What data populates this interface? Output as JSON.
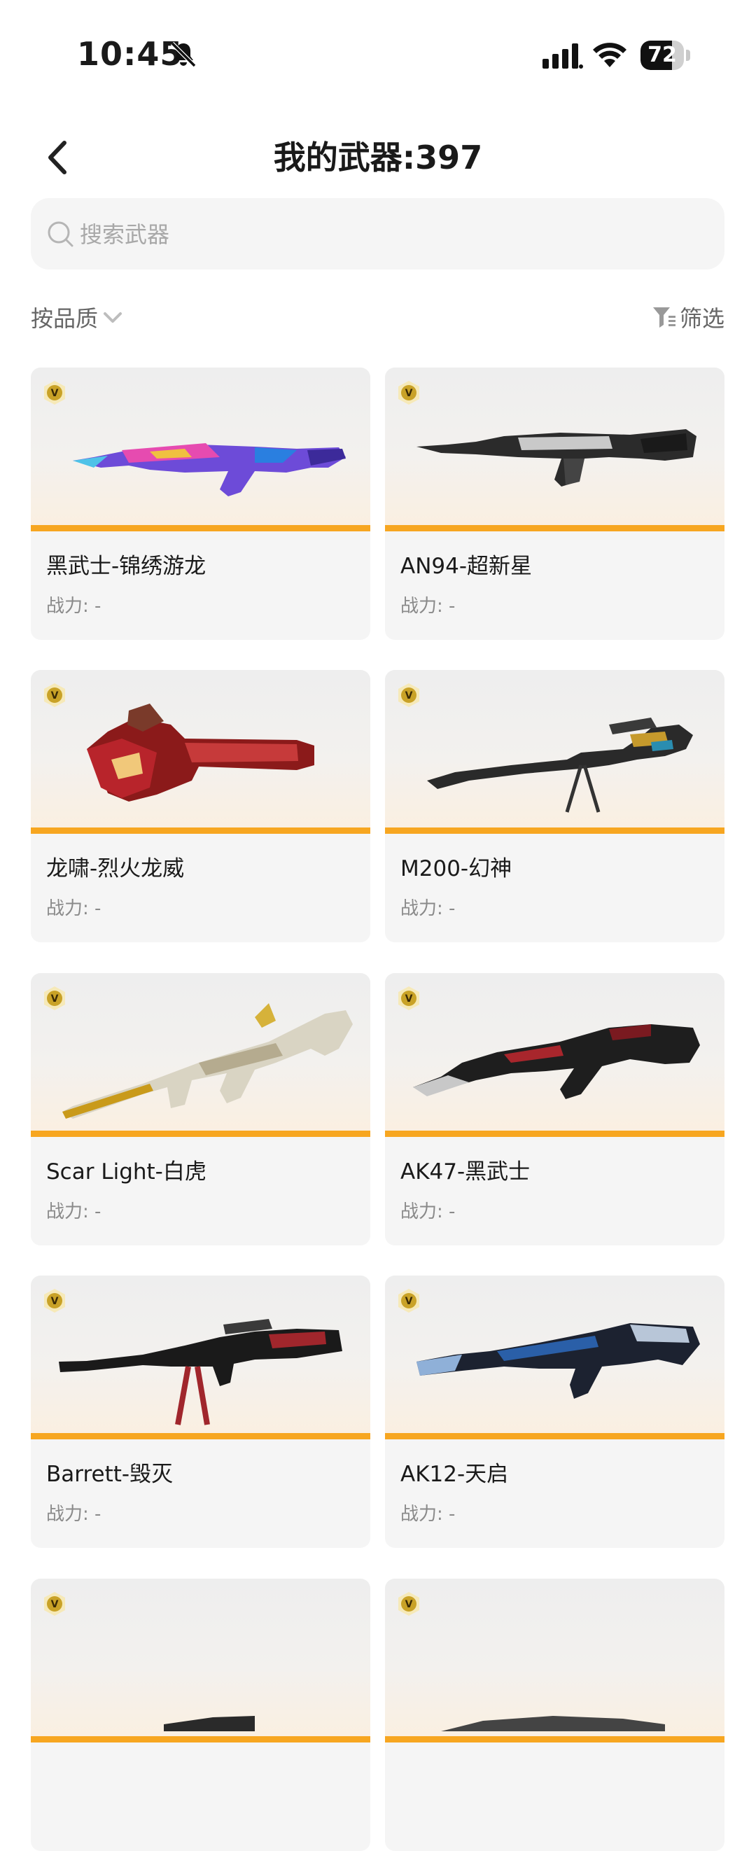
{
  "status": {
    "time": "10:45",
    "battery": "72",
    "battery_level": 0.72
  },
  "header": {
    "title": "我的武器:397"
  },
  "search": {
    "placeholder": "搜索武器",
    "value": ""
  },
  "filters": {
    "sort_label": "按品质",
    "filter_label": "筛选"
  },
  "weapons": [
    {
      "name": "黑武士-锦绣游龙",
      "power_label": "战力: -"
    },
    {
      "name": "AN94-超新星",
      "power_label": "战力: -"
    },
    {
      "name": "龙啸-烈火龙威",
      "power_label": "战力: -"
    },
    {
      "name": "M200-幻神",
      "power_label": "战力: -"
    },
    {
      "name": "Scar Light-白虎",
      "power_label": "战力: -"
    },
    {
      "name": "AK47-黑武士",
      "power_label": "战力: -"
    },
    {
      "name": "Barrett-毁灭",
      "power_label": "战力: -"
    },
    {
      "name": "AK12-天启",
      "power_label": "战力: -"
    },
    {
      "name": "",
      "power_label": ""
    },
    {
      "name": "",
      "power_label": ""
    }
  ],
  "colors": {
    "accent_bar": "#f7a620",
    "badge": "#c9a227",
    "card_bg": "#f5f5f5"
  }
}
